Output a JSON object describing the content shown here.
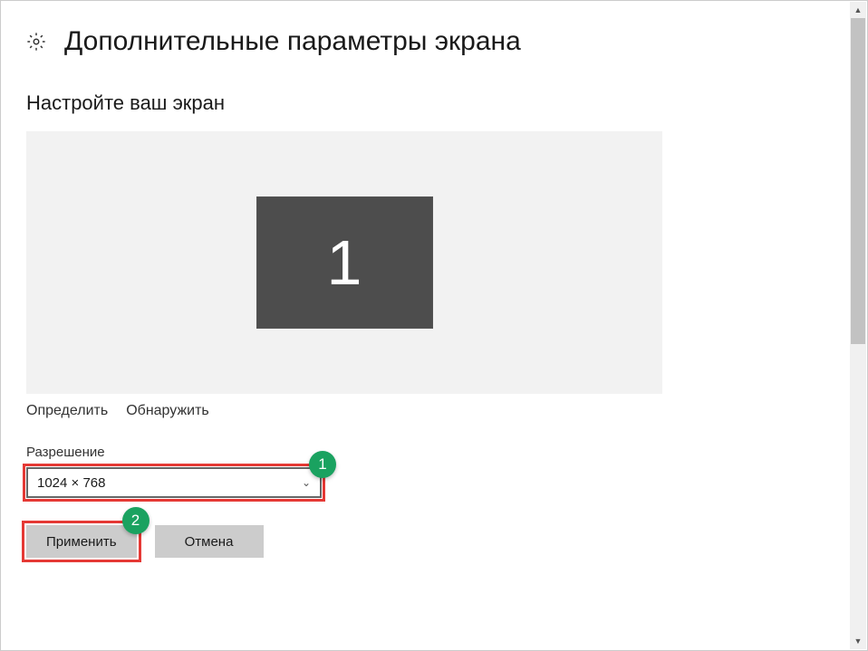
{
  "header": {
    "title": "Дополнительные параметры экрана"
  },
  "subtitle": "Настройте ваш экран",
  "monitor": {
    "number": "1"
  },
  "links": {
    "identify": "Определить",
    "detect": "Обнаружить"
  },
  "resolution": {
    "label": "Разрешение",
    "value": "1024 × 768"
  },
  "buttons": {
    "apply": "Применить",
    "cancel": "Отмена"
  },
  "annotations": {
    "badge1": "1",
    "badge2": "2"
  }
}
